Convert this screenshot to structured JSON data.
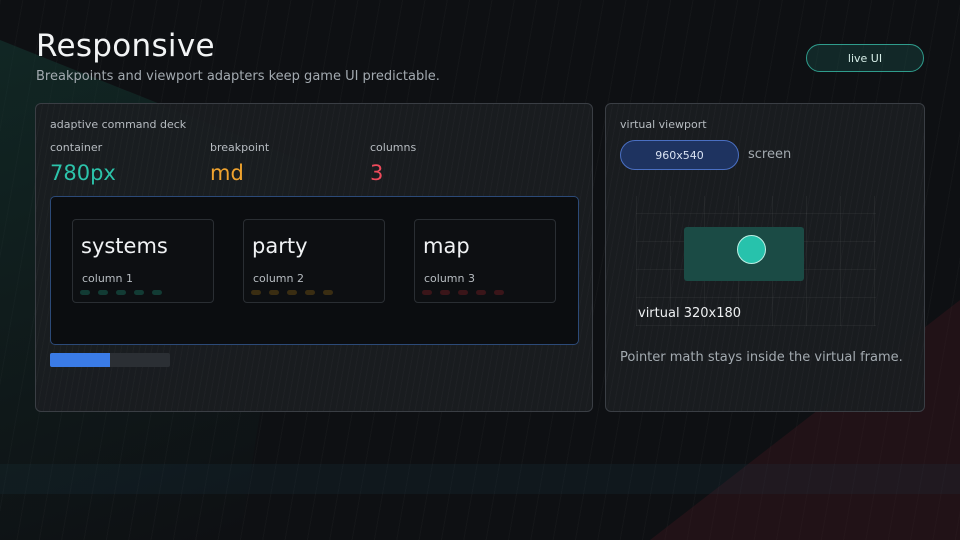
{
  "header": {
    "title": "Responsive",
    "subtitle": "Breakpoints and viewport adapters keep game UI predictable.",
    "live_button": "live UI"
  },
  "deck": {
    "label": "adaptive command deck",
    "stats": [
      {
        "label": "container",
        "value": "780px",
        "color": "#2cc3aa"
      },
      {
        "label": "breakpoint",
        "value": "md",
        "color": "#f0a32e"
      },
      {
        "label": "columns",
        "value": "3",
        "color": "#ee4a5b"
      }
    ],
    "columns": [
      {
        "title": "systems",
        "subtitle": "column 1",
        "dot_color": "#123b34"
      },
      {
        "title": "party",
        "subtitle": "column 2",
        "dot_color": "#3a2d12"
      },
      {
        "title": "map",
        "subtitle": "column 3",
        "dot_color": "#3a1519"
      }
    ],
    "progress": 0.5
  },
  "viewport": {
    "label": "virtual viewport",
    "resolution": "960x540",
    "screen_label": "screen",
    "virtual_label": "virtual 320x180",
    "note": "Pointer math stays inside the virtual frame."
  }
}
